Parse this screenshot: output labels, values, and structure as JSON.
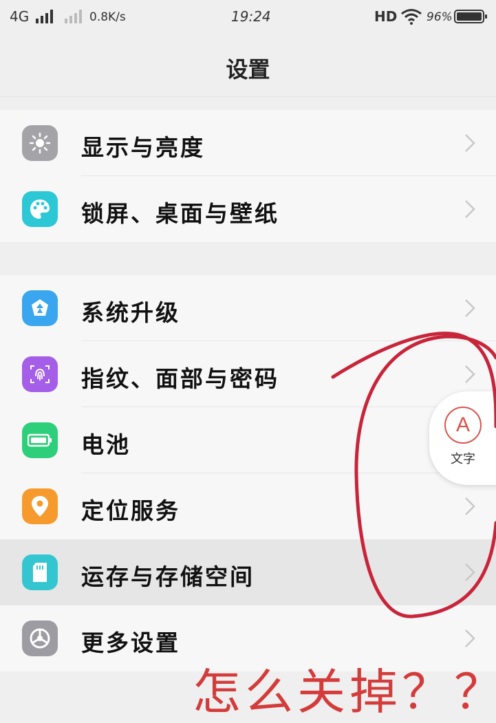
{
  "status_bar": {
    "network": "4G",
    "speed": "0.8K/s",
    "time": "19:24",
    "hd": "HD",
    "battery": "96%"
  },
  "header": {
    "title": "设置"
  },
  "groups": [
    {
      "items": [
        {
          "label": "显示与亮度",
          "icon": "brightness-icon",
          "color": "#a3a3a8"
        },
        {
          "label": "锁屏、桌面与壁纸",
          "icon": "palette-icon",
          "color": "#2cc8d6"
        }
      ]
    },
    {
      "items": [
        {
          "label": "系统升级",
          "icon": "upgrade-icon",
          "color": "#3aa6f0"
        },
        {
          "label": "指纹、面部与密码",
          "icon": "fingerprint-icon",
          "color": "#a45ee8"
        },
        {
          "label": "电池",
          "icon": "battery-icon",
          "color": "#2ecf7b"
        },
        {
          "label": "定位服务",
          "icon": "location-icon",
          "color": "#f79a2d"
        },
        {
          "label": "运存与存储空间",
          "icon": "sdcard-icon",
          "color": "#33c6d1"
        },
        {
          "label": "更多设置",
          "icon": "gear-icon",
          "color": "#9c9ca2"
        }
      ]
    }
  ],
  "floating_button": {
    "glyph": "A",
    "label": "文字",
    "accent": "#d9534f"
  },
  "annotation": {
    "text": "怎么关掉？？",
    "color": "#d43b3b"
  }
}
